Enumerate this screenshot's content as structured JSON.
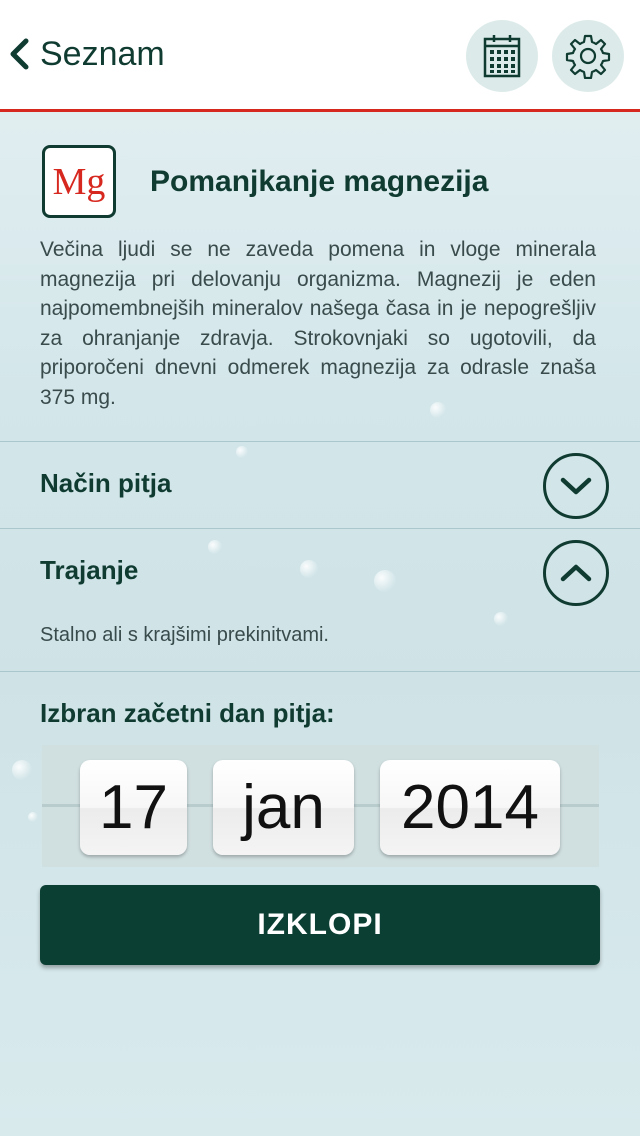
{
  "header": {
    "back_label": "Seznam",
    "calendar_icon": "calendar-icon",
    "settings_icon": "gear-icon"
  },
  "mineral": {
    "symbol": "Mg",
    "title": "Pomanjkanje magnezija",
    "description": "Večina ljudi se ne zaveda pomena in vloge minerala magnezija pri delovanju organizma. Magnezij je eden najpomembnejših mineralov našega časa in je nepogrešljiv za ohranjanje zdravja. Strokovnjaki so ugotovili, da priporočeni dnevni odmerek magnezija za odrasle znaša 375 mg."
  },
  "sections": [
    {
      "label": "Način pitja",
      "expanded": false,
      "text": ""
    },
    {
      "label": "Trajanje",
      "expanded": true,
      "text": "Stalno ali s krajšimi prekinitvami."
    }
  ],
  "start_date": {
    "label": "Izbran začetni dan pitja:",
    "day": "17",
    "month": "jan",
    "year": "2014"
  },
  "action": {
    "label": "IZKLOPI"
  },
  "colors": {
    "accent_red": "#d7281f",
    "dark_green": "#0b3f33"
  }
}
